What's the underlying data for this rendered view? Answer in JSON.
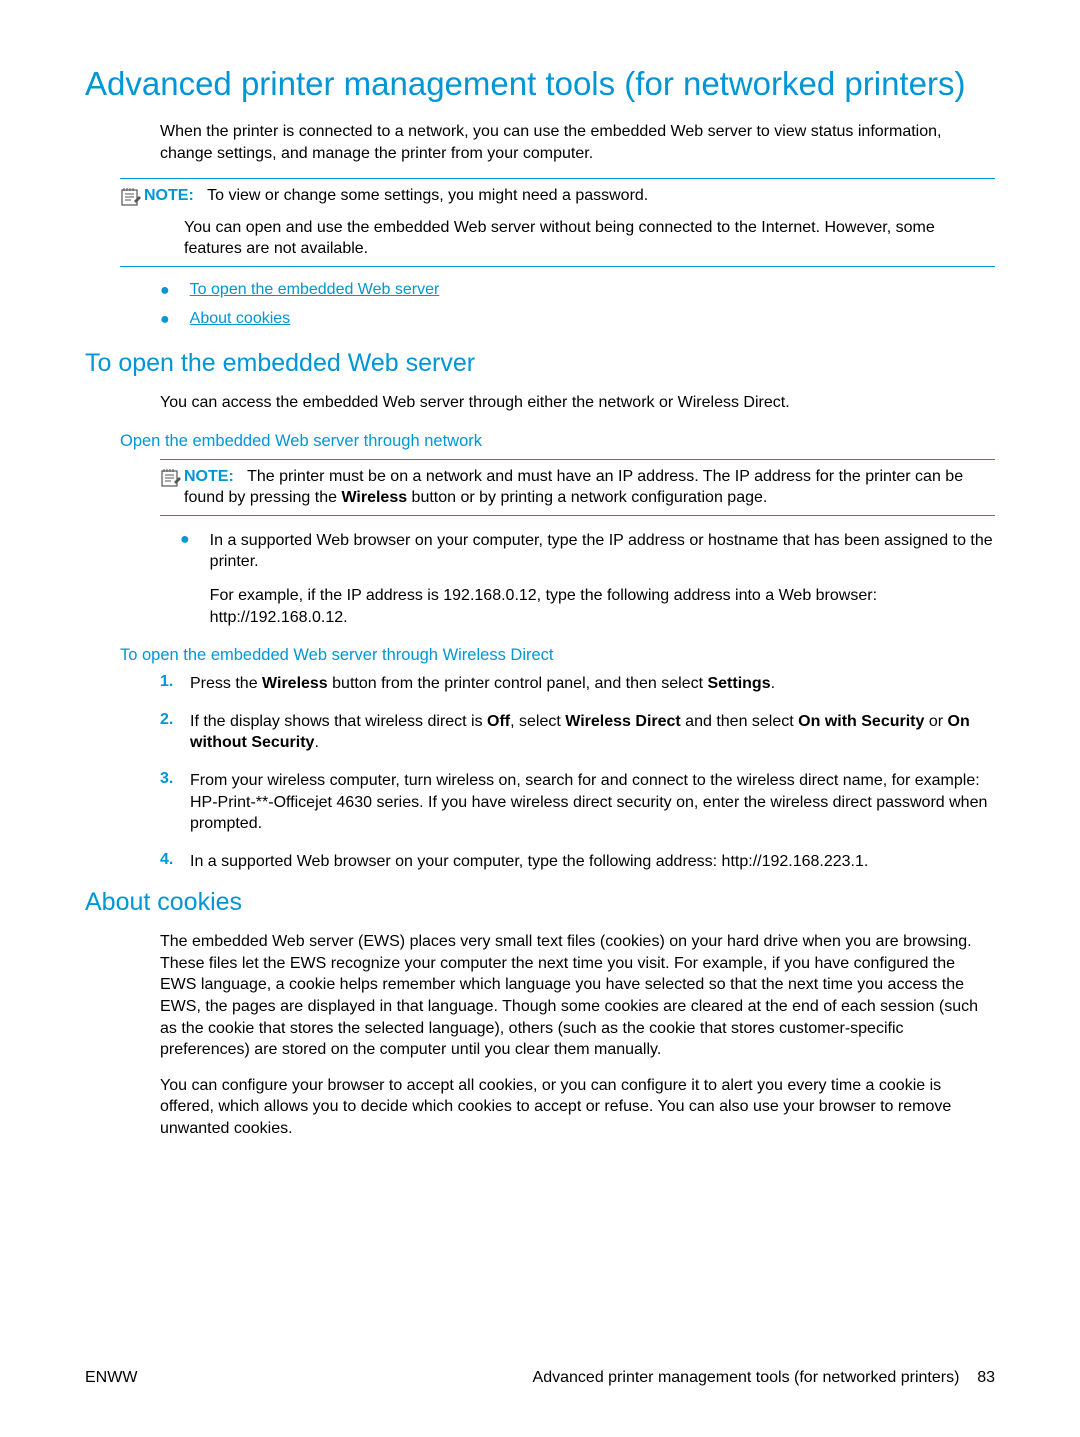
{
  "title": "Advanced printer management tools (for networked printers)",
  "intro": "When the printer is connected to a network, you can use the embedded Web server to view status information, change settings, and manage the printer from your computer.",
  "note1": {
    "label": "NOTE:",
    "line1": "To view or change some settings, you might need a password.",
    "line2": "You can open and use the embedded Web server without being connected to the Internet. However, some features are not available."
  },
  "toc": {
    "item1": "To open the embedded Web server",
    "item2": "About cookies"
  },
  "section1": {
    "title": "To open the embedded Web server",
    "intro": "You can access the embedded Web server through either the network or Wireless Direct.",
    "sub1": {
      "title": "Open the embedded Web server through network",
      "note": {
        "label": "NOTE:",
        "text_a": "The printer must be on a network and must have an IP address. The IP address for the printer can be found by pressing the ",
        "text_bold": "Wireless",
        "text_b": " button or by printing a network configuration page."
      },
      "bullet": {
        "p1": "In a supported Web browser on your computer, type the IP address or hostname that has been assigned to the printer.",
        "p2": "For example, if the IP address is 192.168.0.12, type the following address into a Web browser: http://192.168.0.12."
      }
    },
    "sub2": {
      "title": "To open the embedded Web server through Wireless Direct",
      "step1_a": "Press the ",
      "step1_b1": "Wireless",
      "step1_c": " button from the printer control panel, and then select ",
      "step1_b2": "Settings",
      "step1_d": ".",
      "step2_a": "If the display shows that wireless direct is ",
      "step2_b1": "Off",
      "step2_c": ", select ",
      "step2_b2": "Wireless Direct",
      "step2_d": " and then select ",
      "step2_b3": "On with Security",
      "step2_e": " or ",
      "step2_b4": "On without Security",
      "step2_f": ".",
      "step3": "From your wireless computer, turn wireless on, search for and connect to the wireless direct name, for example: HP-Print-**-Officejet 4630 series. If you have wireless direct security on, enter the wireless direct password when prompted.",
      "step4": "In a supported Web browser on your computer, type the following address: http://192.168.223.1."
    }
  },
  "section2": {
    "title": "About cookies",
    "p1": "The embedded Web server (EWS) places very small text files (cookies) on your hard drive when you are browsing. These files let the EWS recognize your computer the next time you visit. For example, if you have configured the EWS language, a cookie helps remember which language you have selected so that the next time you access the EWS, the pages are displayed in that language. Though some cookies are cleared at the end of each session (such as the cookie that stores the selected language), others (such as the cookie that stores customer-specific preferences) are stored on the computer until you clear them manually.",
    "p2": "You can configure your browser to accept all cookies, or you can configure it to alert you every time a cookie is offered, which allows you to decide which cookies to accept or refuse. You can also use your browser to remove unwanted cookies."
  },
  "footer": {
    "left": "ENWW",
    "right_text": "Advanced printer management tools (for networked printers)",
    "right_page": "83"
  },
  "numbers": {
    "n1": "1.",
    "n2": "2.",
    "n3": "3.",
    "n4": "4."
  }
}
